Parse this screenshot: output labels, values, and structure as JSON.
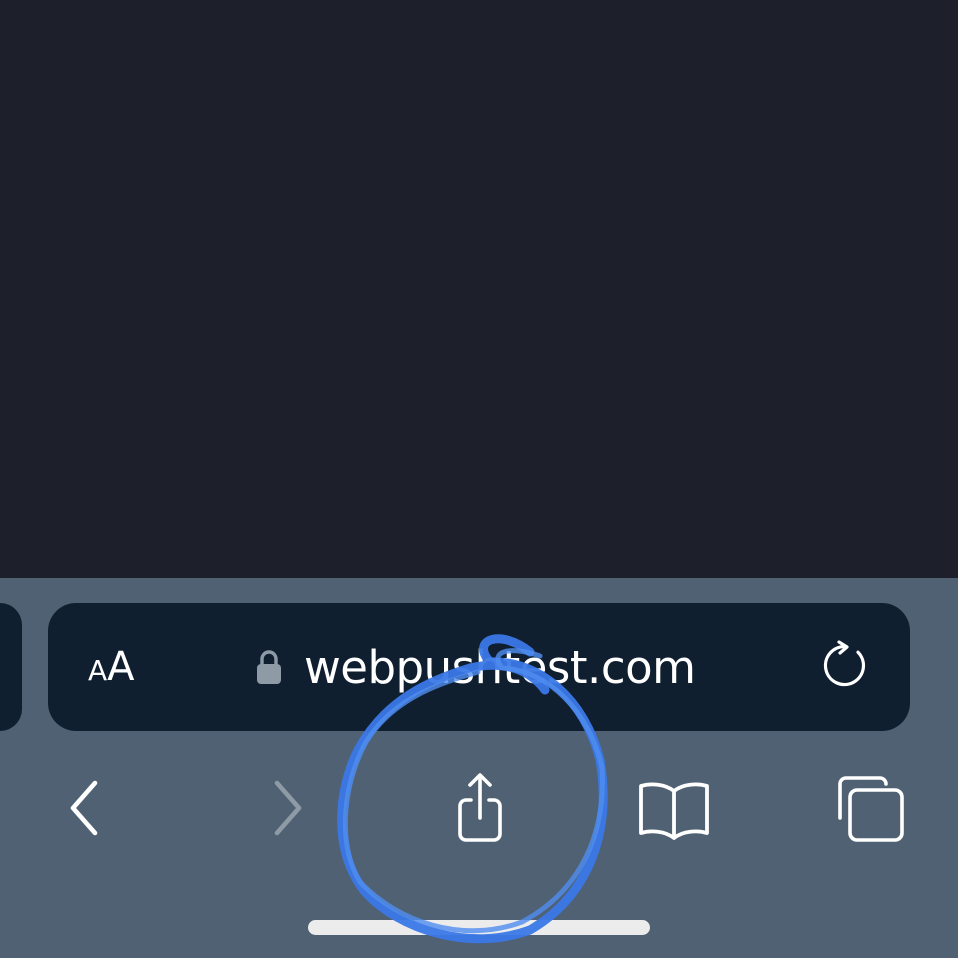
{
  "address_bar": {
    "aa_label_small": "A",
    "aa_label_large": "A",
    "url": "webpushtest.com",
    "lock_icon": "lock-icon",
    "reload_icon": "reload-icon"
  },
  "bottom_toolbar": {
    "back_icon": "chevron-left-icon",
    "forward_icon": "chevron-right-icon",
    "forward_enabled": false,
    "share_icon": "share-icon",
    "bookmarks_icon": "book-icon",
    "tabs_icon": "tabs-icon"
  },
  "annotation": {
    "type": "hand-drawn circle",
    "highlights": "share-button",
    "color": "#3b78e7"
  },
  "colors": {
    "page_background": "#1d1f2b",
    "toolbar_background": "#4f6172",
    "address_bar_background": "#0f1f30",
    "icon_active": "#ffffff",
    "icon_disabled": "#8e9aa6"
  }
}
